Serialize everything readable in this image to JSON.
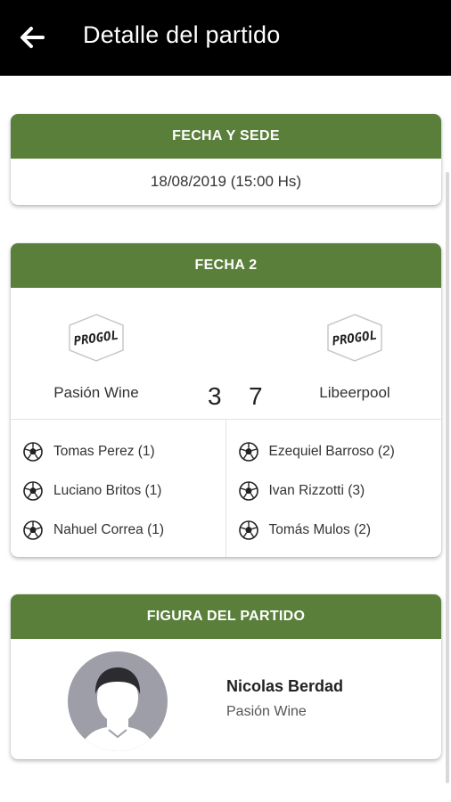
{
  "appbar": {
    "title": "Detalle del partido",
    "back_icon": "arrow-left-icon"
  },
  "fecha_sede": {
    "header": "FECHA Y SEDE",
    "datetime": "18/08/2019 (15:00 Hs)"
  },
  "match": {
    "header": "FECHA 2",
    "home": {
      "name": "Pasión Wine",
      "logo_text": "PROGOL",
      "score": "3"
    },
    "away": {
      "name": "Libeerpool",
      "logo_text": "PROGOL",
      "score": "7"
    },
    "home_scorers": [
      {
        "label": "Tomas Perez (1)"
      },
      {
        "label": "Luciano Britos (1)"
      },
      {
        "label": "Nahuel Correa (1)"
      }
    ],
    "away_scorers": [
      {
        "label": "Ezequiel Barroso (2)"
      },
      {
        "label": "Ivan Rizzotti (3)"
      },
      {
        "label": "Tomás Mulos (2)"
      }
    ]
  },
  "mvp": {
    "header": "FIGURA DEL PARTIDO",
    "name": "Nicolas Berdad",
    "team": "Pasión Wine"
  },
  "colors": {
    "header_green": "#5a7f3b",
    "appbar": "#000000",
    "avatar_bg": "#9e9ea8"
  }
}
